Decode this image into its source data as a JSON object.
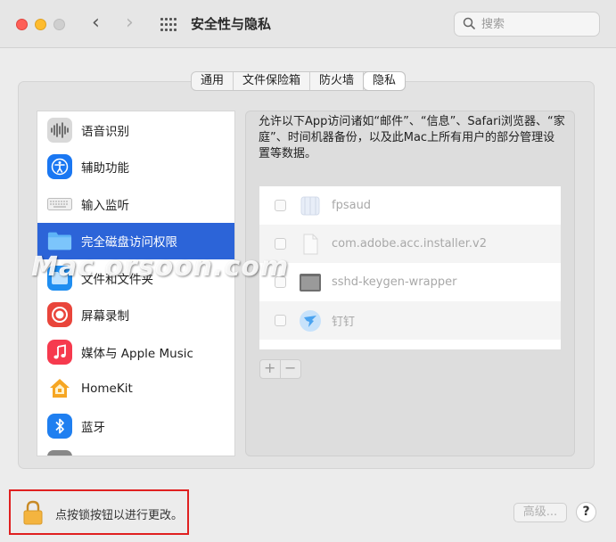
{
  "window": {
    "title": "安全性与隐私"
  },
  "search": {
    "placeholder": "搜索"
  },
  "tabs": [
    {
      "label": "通用",
      "active": false
    },
    {
      "label": "文件保险箱",
      "active": false
    },
    {
      "label": "防火墙",
      "active": false
    },
    {
      "label": "隐私",
      "active": true
    }
  ],
  "sidebar": {
    "items": [
      {
        "label": "语音识别",
        "icon": "speech-recognition-icon"
      },
      {
        "label": "辅助功能",
        "icon": "accessibility-icon"
      },
      {
        "label": "输入监听",
        "icon": "keyboard-icon"
      },
      {
        "label": "完全磁盘访问权限",
        "icon": "folder-icon",
        "selected": true
      },
      {
        "label": "文件和文件夹",
        "icon": "files-folders-icon"
      },
      {
        "label": "屏幕录制",
        "icon": "screen-recording-icon"
      },
      {
        "label": "媒体与 Apple Music",
        "icon": "music-icon"
      },
      {
        "label": "HomeKit",
        "icon": "homekit-icon"
      },
      {
        "label": "蓝牙",
        "icon": "bluetooth-icon"
      }
    ]
  },
  "main": {
    "description": "允许以下App访问诸如“邮件”、“信息”、Safari浏览器、“家庭”、时间机器备份，以及此Mac上所有用户的部分管理设置等数据。",
    "apps": [
      {
        "name": "fpsaud",
        "checked": false
      },
      {
        "name": "com.adobe.acc.installer.v2",
        "checked": false
      },
      {
        "name": "sshd-keygen-wrapper",
        "checked": false
      },
      {
        "name": "钉钉",
        "checked": false
      }
    ],
    "add_label": "+",
    "remove_label": "−"
  },
  "watermark": "Mac orsoon.com",
  "footer": {
    "lock_text": "点按锁按钮以进行更改。",
    "advanced_label": "高级...",
    "help_label": "?"
  },
  "colors": {
    "selection": "#2c64d8",
    "highlight_box": "#e02020"
  }
}
